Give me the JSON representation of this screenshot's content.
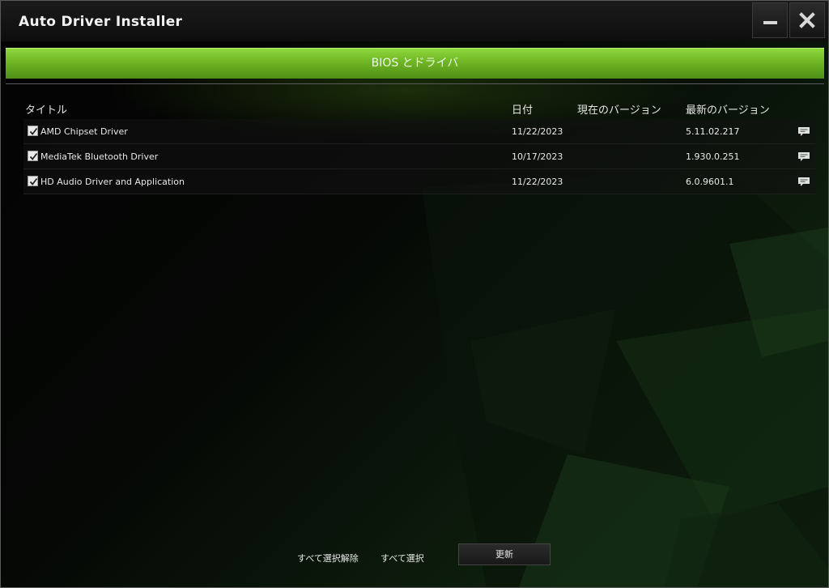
{
  "window": {
    "title": "Auto Driver Installer"
  },
  "tabs": [
    {
      "label": "BIOS とドライバ",
      "active": true
    }
  ],
  "table": {
    "headers": {
      "title": "タイトル",
      "date": "日付",
      "current_version": "現在のバージョン",
      "latest_version": "最新のバージョン"
    },
    "rows": [
      {
        "checked": true,
        "title": "AMD Chipset Driver",
        "date": "11/22/2023",
        "current_version": "",
        "latest_version": "5.11.02.217"
      },
      {
        "checked": true,
        "title": "MediaTek Bluetooth Driver",
        "date": "10/17/2023",
        "current_version": "",
        "latest_version": "1.930.0.251"
      },
      {
        "checked": true,
        "title": "HD Audio Driver and Application",
        "date": "11/22/2023",
        "current_version": "",
        "latest_version": "6.0.9601.1"
      }
    ]
  },
  "footer": {
    "deselect_all": "すべて選択解除",
    "select_all": "すべて選択",
    "update_button": "更新"
  },
  "icons": {
    "minimize": "minimize-icon",
    "close": "close-icon",
    "checkbox": "checkmark-icon",
    "release_notes": "speech-bubble-icon"
  },
  "colors": {
    "accent_green": "#6fb524",
    "background": "#050505",
    "text": "#e8e8e8"
  }
}
